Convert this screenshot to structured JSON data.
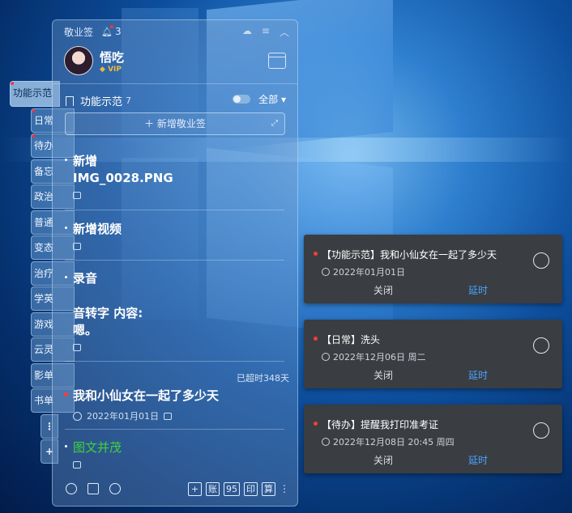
{
  "app": {
    "title": "敬业签",
    "notify_count": "3"
  },
  "user": {
    "name": "悟吃",
    "badge": "VIP"
  },
  "category": {
    "name": "功能示范",
    "count": "7",
    "filter": "全部"
  },
  "add_button": {
    "label": "＋ 新增敬业签"
  },
  "tabs": [
    {
      "label": "功能示范"
    },
    {
      "label": "日常"
    },
    {
      "label": "待办"
    },
    {
      "label": "备忘"
    },
    {
      "label": "政治"
    },
    {
      "label": "普通"
    },
    {
      "label": "变态"
    },
    {
      "label": "治疗"
    },
    {
      "label": "学英"
    },
    {
      "label": "游戏"
    },
    {
      "label": "云灵"
    },
    {
      "label": "影单"
    },
    {
      "label": "书单"
    },
    {
      "label": "⋮"
    },
    {
      "label": "+"
    }
  ],
  "notes": [
    {
      "text": "新增\nIMG_0028.PNG"
    },
    {
      "text": "新增视频"
    },
    {
      "text": "录音"
    },
    {
      "text": "音转字 内容:\n嗯。"
    },
    {
      "overdue": "已超时348天",
      "text": "我和小仙女在一起了多少天",
      "date": "2022年01月01日"
    },
    {
      "text": "图文并茂"
    }
  ],
  "bottom": {
    "buttons": [
      "+",
      "账",
      "95",
      "印",
      "算"
    ]
  },
  "popups": [
    {
      "title": "【功能示范】我和小仙女在一起了多少天",
      "date": "2022年01月01日",
      "close": "关闭",
      "delay": "延时"
    },
    {
      "title": "【日常】洗头",
      "date": "2022年12月06日  周二",
      "close": "关闭",
      "delay": "延时"
    },
    {
      "title": "【待办】提醒我打印准考证",
      "date": "2022年12月08日  20:45  周四",
      "close": "关闭",
      "delay": "延时"
    }
  ],
  "colors": {
    "accent_link": "#4aa3ff",
    "alert_dot": "#ff3a3a",
    "green_text": "#3fd23f",
    "vip": "#f0b93a"
  }
}
